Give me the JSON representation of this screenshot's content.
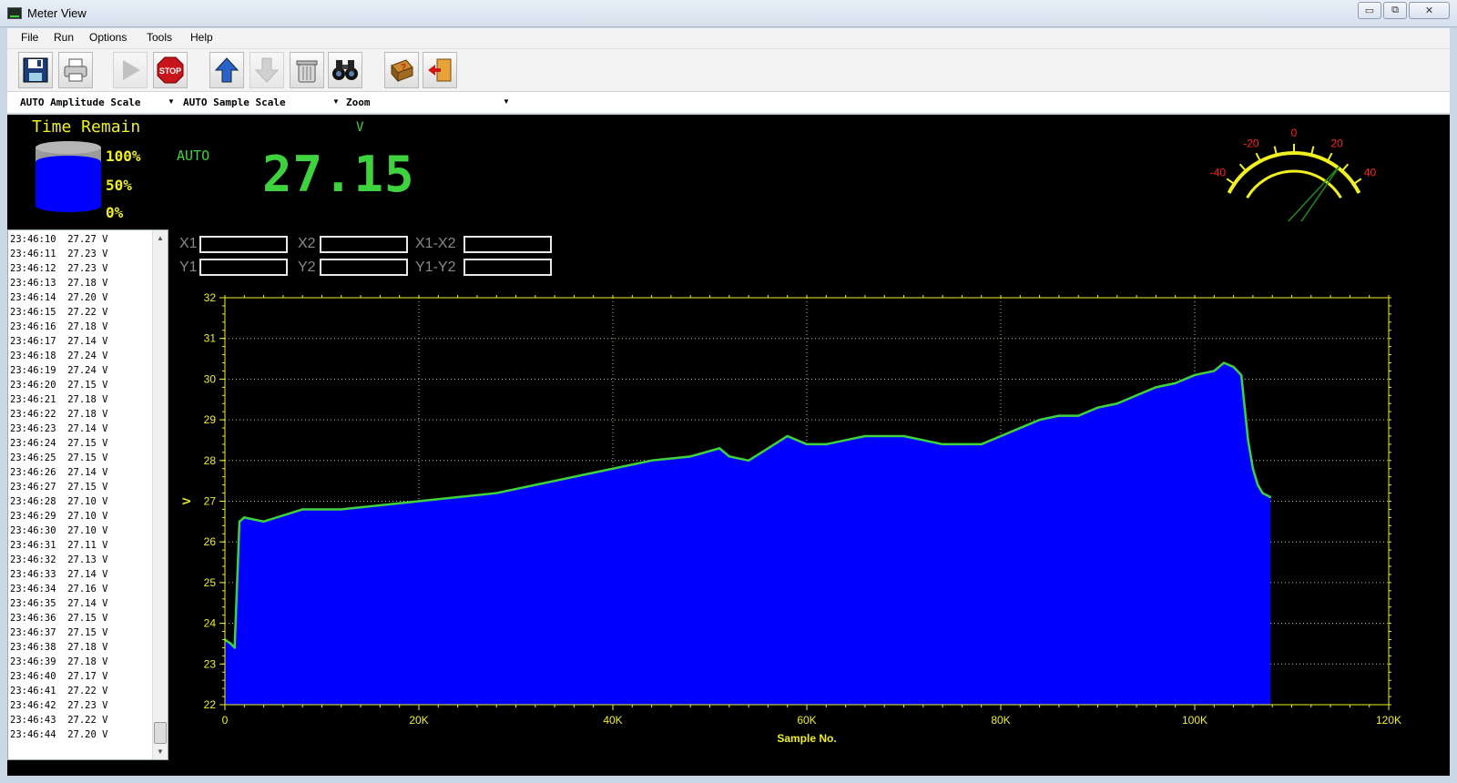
{
  "window": {
    "title": "Meter View",
    "min_glyph": "▭",
    "max_glyph": "⧉",
    "close_glyph": "✕"
  },
  "menu": [
    "File",
    "Run",
    "Options",
    "Tools",
    "Help"
  ],
  "toolbar": {
    "buttons": [
      {
        "name": "save-button",
        "icon": "floppy-disk-icon",
        "enabled": true
      },
      {
        "name": "print-button",
        "icon": "printer-icon",
        "enabled": true
      },
      {
        "name": "run-button",
        "icon": "play-icon",
        "enabled": false
      },
      {
        "name": "stop-button",
        "icon": "stop-sign-icon",
        "enabled": true,
        "label": "STOP"
      },
      {
        "name": "upload-button",
        "icon": "arrow-up-icon",
        "enabled": true
      },
      {
        "name": "download-button",
        "icon": "arrow-down-icon",
        "enabled": false
      },
      {
        "name": "clear-button",
        "icon": "trash-can-icon",
        "enabled": true
      },
      {
        "name": "find-button",
        "icon": "binoculars-icon",
        "enabled": true
      },
      {
        "name": "help-button",
        "icon": "help-book-icon",
        "enabled": true
      },
      {
        "name": "exit-button",
        "icon": "exit-door-icon",
        "enabled": true
      }
    ]
  },
  "scales": {
    "amplitude": "AUTO Amplitude Scale",
    "sample": "AUTO Sample Scale",
    "zoom": "Zoom"
  },
  "status": {
    "time_remain_label": "Time Remain",
    "pct_100": "100%",
    "pct_50": "50%",
    "pct_0": "0%",
    "tank_level": 0.75,
    "auto": "AUTO",
    "unit": "V",
    "reading": "27.15"
  },
  "gauge": {
    "ticks": [
      "-40",
      "-20",
      "0",
      "20",
      "40"
    ],
    "needle_value": 27.15,
    "colors": {
      "arc": "#f0f020",
      "tick_labels": "#ff2020",
      "needle": "#1f8a1f"
    }
  },
  "log": [
    "23:46:10  27.27 V",
    "23:46:11  27.23 V",
    "23:46:12  27.23 V",
    "23:46:13  27.18 V",
    "23:46:14  27.20 V",
    "23:46:15  27.22 V",
    "23:46:16  27.18 V",
    "23:46:17  27.14 V",
    "23:46:18  27.24 V",
    "23:46:19  27.24 V",
    "23:46:20  27.15 V",
    "23:46:21  27.18 V",
    "23:46:22  27.18 V",
    "23:46:23  27.14 V",
    "23:46:24  27.15 V",
    "23:46:25  27.15 V",
    "23:46:26  27.14 V",
    "23:46:27  27.15 V",
    "23:46:28  27.10 V",
    "23:46:29  27.10 V",
    "23:46:30  27.10 V",
    "23:46:31  27.11 V",
    "23:46:32  27.13 V",
    "23:46:33  27.14 V",
    "23:46:34  27.16 V",
    "23:46:35  27.14 V",
    "23:46:36  27.15 V",
    "23:46:37  27.15 V",
    "23:46:38  27.18 V",
    "23:46:39  27.18 V",
    "23:46:40  27.17 V",
    "23:46:41  27.22 V",
    "23:46:42  27.23 V",
    "23:46:43  27.22 V",
    "23:46:44  27.20 V"
  ],
  "cursors": {
    "x1_label": "X1",
    "x2_label": "X2",
    "x1_x2_label": "X1-X2",
    "y1_label": "Y1",
    "y2_label": "Y2",
    "y1_y2_label": "Y1-Y2",
    "x1": "",
    "x2": "",
    "x1_x2": "",
    "y1": "",
    "y2": "",
    "y1_y2": ""
  },
  "chart_data": {
    "type": "area",
    "xlabel": "Sample No.",
    "ylabel": "V",
    "xlim": [
      0,
      120000
    ],
    "ylim": [
      22,
      32
    ],
    "x_ticks": [
      "0",
      "20K",
      "40K",
      "60K",
      "80K",
      "100K",
      "120K"
    ],
    "y_ticks": [
      "22",
      "23",
      "24",
      "25",
      "26",
      "27",
      "28",
      "29",
      "30",
      "31",
      "32"
    ],
    "grid": true,
    "fill_color": "#0000ff",
    "line_color": "#3fd23f",
    "axis_color": "#f0f020",
    "series": [
      {
        "x": [
          0,
          600,
          1000,
          1500,
          2000,
          4000,
          8000,
          12000,
          16000,
          20000,
          24000,
          28000,
          32000,
          36000,
          40000,
          44000,
          48000,
          51000,
          52000,
          54000,
          56000,
          58000,
          60000,
          62000,
          64000,
          66000,
          68000,
          70000,
          72000,
          74000,
          76000,
          78000,
          80000,
          82000,
          84000,
          86000,
          88000,
          90000,
          92000,
          94000,
          96000,
          98000,
          100000,
          102000,
          103000,
          104000,
          104800,
          105500,
          106000,
          106500,
          107000,
          107800
        ],
        "y": [
          23.6,
          23.5,
          23.4,
          26.5,
          26.6,
          26.5,
          26.8,
          26.8,
          26.9,
          27.0,
          27.1,
          27.2,
          27.4,
          27.6,
          27.8,
          28.0,
          28.1,
          28.3,
          28.1,
          28.0,
          28.3,
          28.6,
          28.4,
          28.4,
          28.5,
          28.6,
          28.6,
          28.6,
          28.5,
          28.4,
          28.4,
          28.4,
          28.6,
          28.8,
          29.0,
          29.1,
          29.1,
          29.3,
          29.4,
          29.6,
          29.8,
          29.9,
          30.1,
          30.2,
          30.4,
          30.3,
          30.1,
          28.5,
          27.8,
          27.4,
          27.2,
          27.1
        ]
      }
    ]
  }
}
